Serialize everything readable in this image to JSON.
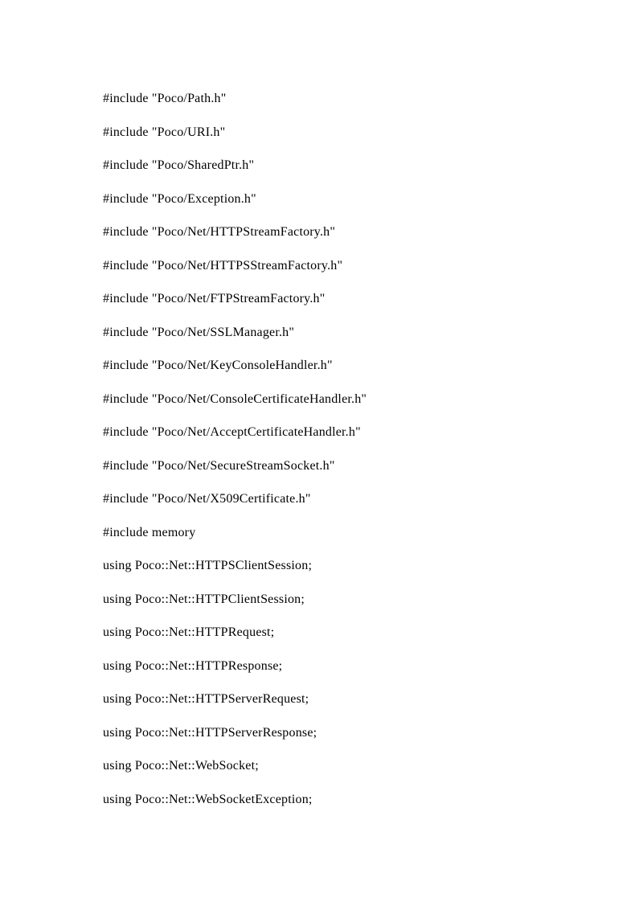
{
  "lines": [
    "#include \"Poco/Path.h\"",
    "#include \"Poco/URI.h\"",
    "#include \"Poco/SharedPtr.h\"",
    "#include \"Poco/Exception.h\"",
    "#include \"Poco/Net/HTTPStreamFactory.h\"",
    "#include \"Poco/Net/HTTPSStreamFactory.h\"",
    "#include \"Poco/Net/FTPStreamFactory.h\"",
    "#include \"Poco/Net/SSLManager.h\"",
    "#include \"Poco/Net/KeyConsoleHandler.h\"",
    "#include \"Poco/Net/ConsoleCertificateHandler.h\"",
    "#include \"Poco/Net/AcceptCertificateHandler.h\"",
    "#include \"Poco/Net/SecureStreamSocket.h\"",
    "#include \"Poco/Net/X509Certificate.h\"",
    "#include memory",
    "using Poco::Net::HTTPSClientSession;",
    "using Poco::Net::HTTPClientSession;",
    "using Poco::Net::HTTPRequest;",
    "using Poco::Net::HTTPResponse;",
    "using Poco::Net::HTTPServerRequest;",
    "using Poco::Net::HTTPServerResponse;",
    "using Poco::Net::WebSocket;",
    "using Poco::Net::WebSocketException;"
  ]
}
